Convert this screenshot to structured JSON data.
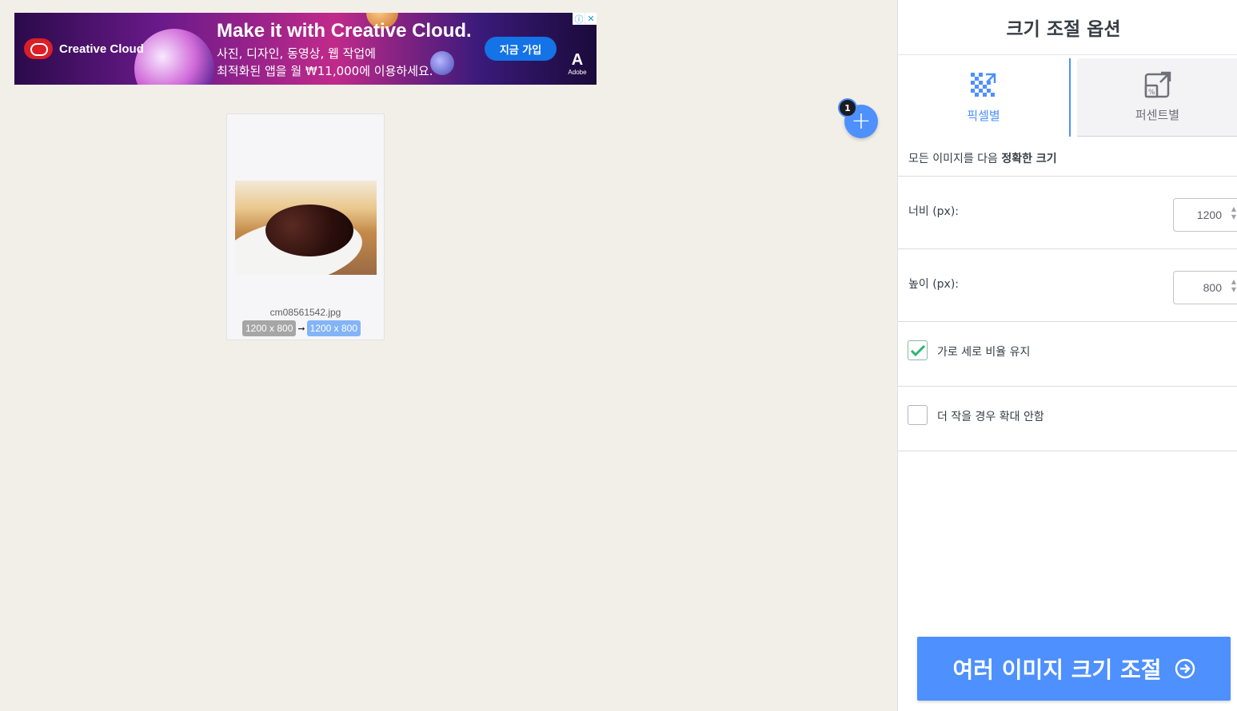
{
  "ad": {
    "brand": "Creative Cloud",
    "headline": "Make it with Creative Cloud.",
    "line1": "사진, 디자인, 동영상, 웹 작업에",
    "line2": "최적화된 앱을 월 ₩11,000에 이용하세요.",
    "cta": "지금 가입",
    "adobe_mark": "A",
    "adobe_label": "Adobe",
    "info_icon": "ⓘ",
    "close_icon": "✕"
  },
  "card": {
    "filename": "cm08561542.jpg",
    "original_size": "1200 x 800",
    "arrow": "➞",
    "new_size": "1200 x 800"
  },
  "add_button": {
    "count": "1",
    "plus": "+"
  },
  "sidebar": {
    "title": "크기 조절 옵션",
    "tabs": [
      {
        "label": "픽셀별",
        "icon": "pixel-resize-icon",
        "active": true
      },
      {
        "label": "퍼센트별",
        "icon": "percent-resize-icon",
        "active": false
      }
    ],
    "description_prefix": "모든 이미지를 다음 ",
    "description_bold": "정확한 크기",
    "width_label": "너비 (px):",
    "width_value": "1200",
    "height_label": "높이 (px):",
    "height_value": "800",
    "keep_ratio_label": "가로 세로 비율 유지",
    "keep_ratio_checked": true,
    "no_enlarge_label": "더 작을 경우 확대 안함",
    "no_enlarge_checked": false,
    "submit_label": "여러 이미지 크기 조절"
  },
  "colors": {
    "accent": "#4d90fe",
    "check_green": "#2bb673",
    "background": "#f2efe9"
  }
}
